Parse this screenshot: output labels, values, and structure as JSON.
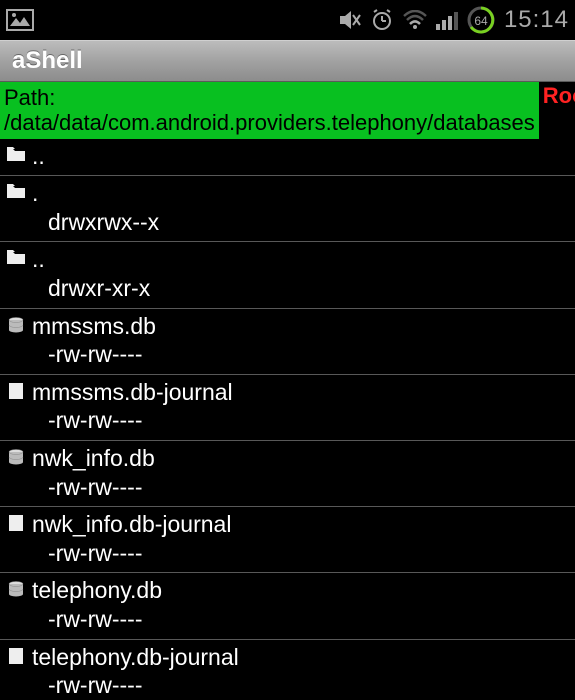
{
  "status_bar": {
    "time": "15:14",
    "battery_percent": "64"
  },
  "app": {
    "title": "aShell"
  },
  "path": {
    "label_prefix": "Path: ",
    "value": "/data/data/com.android.providers.telephony/databases",
    "root_badge": "Root"
  },
  "files": [
    {
      "icon": "folder",
      "name": "..",
      "perms": ""
    },
    {
      "icon": "folder",
      "name": ".",
      "perms": "drwxrwx--x"
    },
    {
      "icon": "folder",
      "name": "..",
      "perms": "drwxr-xr-x"
    },
    {
      "icon": "db",
      "name": "mmssms.db",
      "perms": "-rw-rw----"
    },
    {
      "icon": "file",
      "name": "mmssms.db-journal",
      "perms": "-rw-rw----"
    },
    {
      "icon": "db",
      "name": "nwk_info.db",
      "perms": "-rw-rw----"
    },
    {
      "icon": "file",
      "name": "nwk_info.db-journal",
      "perms": "-rw-rw----"
    },
    {
      "icon": "db",
      "name": "telephony.db",
      "perms": "-rw-rw----"
    },
    {
      "icon": "file",
      "name": "telephony.db-journal",
      "perms": "-rw-rw----"
    }
  ]
}
